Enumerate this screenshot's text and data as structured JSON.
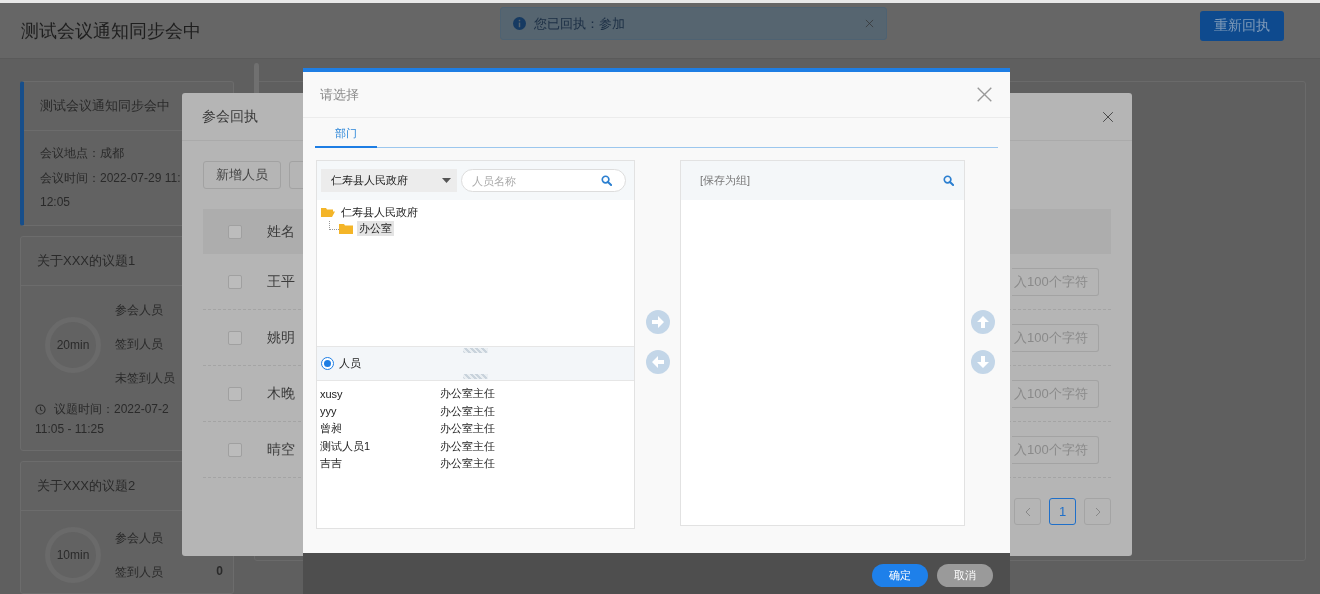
{
  "page": {
    "title": "测试会议通知同步会中",
    "action_button": "重新回执",
    "toast": {
      "message": "您已回执：参加"
    },
    "meeting_card": {
      "title": "测试会议通知同步会中",
      "location": "会议地点：成都",
      "time": "会议时间：2022-07-29 11:",
      "time_end": "12:05"
    },
    "topics": [
      {
        "title": "关于XXX的议题1",
        "duration": "20min",
        "rows": [
          {
            "label": "参会人员"
          },
          {
            "label": "签到人员"
          },
          {
            "label": "未签到人员"
          }
        ],
        "time": "议题时间：2022-07-2",
        "time_range": "11:05 - 11:25"
      },
      {
        "title": "关于XXX的议题2",
        "duration": "10min",
        "rows": [
          {
            "label": "参会人员"
          },
          {
            "label": "签到人员",
            "value": "0"
          }
        ]
      }
    ]
  },
  "receipt_dialog": {
    "title": "参会回执",
    "buttons": [
      "新增人员"
    ],
    "columns": [
      "姓名"
    ],
    "all_checked": false,
    "rows": [
      {
        "name": "王平",
        "checked": false,
        "remark_placeholder": "入100个字符"
      },
      {
        "name": "姚明",
        "checked": false,
        "remark_placeholder": "入100个字符"
      },
      {
        "name": "木晚",
        "checked": false,
        "remark_placeholder": "入100个字符"
      },
      {
        "name": "晴空",
        "checked": false,
        "remark_placeholder": "入100个字符"
      }
    ],
    "pages": [
      {
        "label": "1",
        "selected": true
      }
    ]
  },
  "select_dialog": {
    "title": "请选择",
    "tabs": [
      {
        "label": "部门",
        "selected": true
      }
    ],
    "org_select": "仁寿县人民政府",
    "search": {
      "placeholder": "人员名称"
    },
    "tree": [
      {
        "label": "仁寿县人民政府",
        "expanded": true,
        "selected": false,
        "children": [
          {
            "label": "办公室",
            "expanded": false,
            "selected": true
          }
        ]
      }
    ],
    "mode": {
      "label": "人员",
      "checked": true
    },
    "people": [
      {
        "name": "xusy",
        "position": "办公室主任"
      },
      {
        "name": "yyy",
        "position": "办公室主任"
      },
      {
        "name": "曾昶",
        "position": "办公室主任"
      },
      {
        "name": "测试人员1",
        "position": "办公室主任"
      },
      {
        "name": "吉吉",
        "position": "办公室主任"
      }
    ],
    "selected_header": "[保存为组]",
    "footer_buttons": [
      {
        "label": "确定",
        "kind": "primary"
      },
      {
        "label": "取消",
        "kind": "secondary"
      }
    ]
  }
}
